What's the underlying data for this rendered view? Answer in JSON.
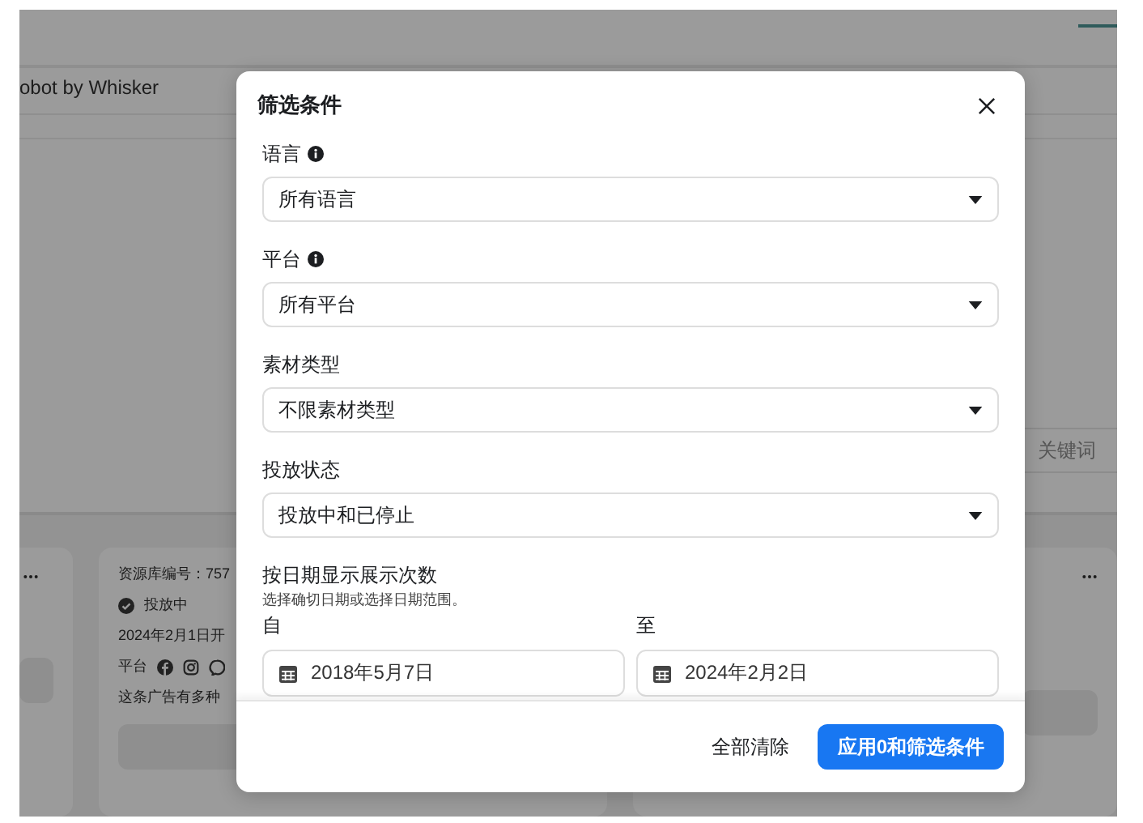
{
  "background": {
    "header_text": "obot by Whisker",
    "keyword_field": {
      "placeholder": "关键词"
    },
    "card": {
      "library_id": "资源库编号：757",
      "status": "投放中",
      "start_date": "2024年2月1日开",
      "platform_label": "平台",
      "note": "这条广告有多种"
    }
  },
  "modal": {
    "title": "筛选条件",
    "filters": [
      {
        "label": "语言",
        "info": true,
        "value": "所有语言"
      },
      {
        "label": "平台",
        "info": true,
        "value": "所有平台"
      },
      {
        "label": "素材类型",
        "info": false,
        "value": "不限素材类型"
      },
      {
        "label": "投放状态",
        "info": false,
        "value": "投放中和已停止"
      }
    ],
    "date_range": {
      "title": "按日期显示展示次数",
      "hint": "选择确切日期或选择日期范围。",
      "from_label": "自",
      "from_value": "2018年5月7日",
      "to_label": "至",
      "to_value": "2024年2月2日"
    },
    "buttons": {
      "clear": "全部清除",
      "apply": "应用0和筛选条件"
    }
  }
}
